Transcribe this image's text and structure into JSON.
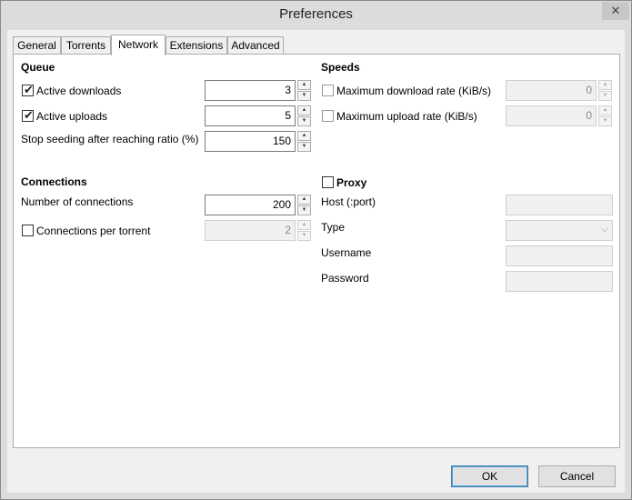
{
  "window": {
    "title": "Preferences",
    "close_glyph": "✕"
  },
  "tabs": [
    {
      "label": "General",
      "active": false
    },
    {
      "label": "Torrents",
      "active": false
    },
    {
      "label": "Network",
      "active": true
    },
    {
      "label": "Extensions",
      "active": false
    },
    {
      "label": "Advanced",
      "active": false
    }
  ],
  "queue": {
    "heading": "Queue",
    "active_downloads": {
      "label": "Active downloads",
      "checked": true,
      "value": "3"
    },
    "active_uploads": {
      "label": "Active uploads",
      "checked": true,
      "value": "5"
    },
    "stop_seeding": {
      "label": "Stop seeding after reaching ratio (%)",
      "value": "150"
    }
  },
  "connections": {
    "heading": "Connections",
    "number": {
      "label": "Number of connections",
      "value": "200"
    },
    "per_torrent": {
      "label": "Connections per torrent",
      "checked": false,
      "value": "2"
    }
  },
  "speeds": {
    "heading": "Speeds",
    "max_download": {
      "label": "Maximum download rate (KiB/s)",
      "checked": false,
      "value": "0"
    },
    "max_upload": {
      "label": "Maximum upload rate (KiB/s)",
      "checked": false,
      "value": "0"
    }
  },
  "proxy": {
    "heading": "Proxy",
    "checked": false,
    "host_label": "Host (:port)",
    "type_label": "Type",
    "username_label": "Username",
    "password_label": "Password",
    "host_value": "",
    "type_value": "",
    "username_value": "",
    "password_value": ""
  },
  "buttons": {
    "ok": "OK",
    "cancel": "Cancel"
  },
  "glyphs": {
    "check": "✔",
    "up": "▲",
    "down": "▼",
    "combo": "⌵"
  }
}
